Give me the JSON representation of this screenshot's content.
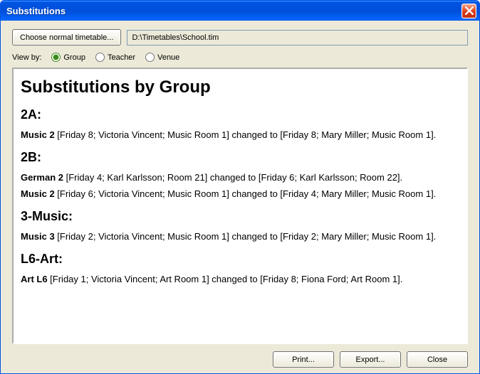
{
  "window": {
    "title": "Substitutions"
  },
  "toolbar": {
    "choose_timetable_label": "Choose normal timetable...",
    "path_value": "D:\\Timetables\\School.tim"
  },
  "viewby": {
    "label": "View by:",
    "options": {
      "group": "Group",
      "teacher": "Teacher",
      "venue": "Venue"
    },
    "selected": "group"
  },
  "report": {
    "heading": "Substitutions by Group",
    "groups": [
      {
        "name": "2A:",
        "rows": [
          {
            "label": "Music 2",
            "text": " [Friday 8; Victoria Vincent; Music Room 1] changed to [Friday 8; Mary Miller; Music Room 1]."
          }
        ]
      },
      {
        "name": "2B:",
        "rows": [
          {
            "label": "German 2",
            "text": " [Friday 4; Karl Karlsson; Room 21] changed to [Friday 6; Karl Karlsson; Room 22]."
          },
          {
            "label": "Music 2",
            "text": " [Friday 6; Victoria Vincent; Music Room 1] changed to [Friday 4; Mary Miller; Music Room 1]."
          }
        ]
      },
      {
        "name": "3-Music:",
        "rows": [
          {
            "label": "Music 3",
            "text": " [Friday 2; Victoria Vincent; Music Room 1] changed to [Friday 2; Mary Miller; Music Room 1]."
          }
        ]
      },
      {
        "name": "L6-Art:",
        "rows": [
          {
            "label": "Art L6",
            "text": " [Friday 1; Victoria Vincent; Art Room 1] changed to [Friday 8; Fiona Ford; Art Room 1]."
          }
        ]
      }
    ]
  },
  "buttons": {
    "print": "Print...",
    "export": "Export...",
    "close": "Close"
  }
}
